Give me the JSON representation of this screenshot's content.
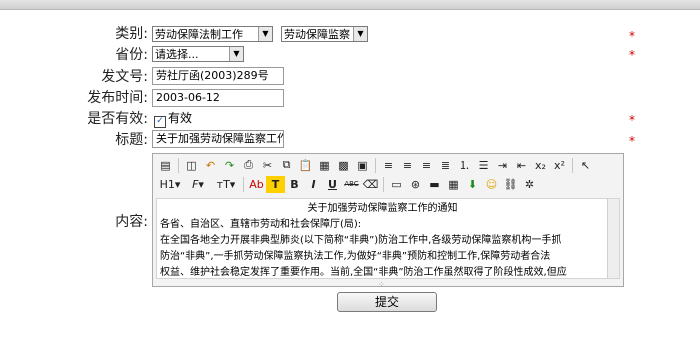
{
  "form": {
    "category": {
      "label": "类别:",
      "value1": "劳动保障法制工作",
      "value2": "劳动保障监察"
    },
    "province": {
      "label": "省份:",
      "value": "请选择..."
    },
    "doc_number": {
      "label": "发文号:",
      "value": "劳社厅函(2003)289号"
    },
    "publish_date": {
      "label": "发布时间:",
      "value": "2003-06-12"
    },
    "valid": {
      "label": "是否有效:",
      "checkbox_label": "有效",
      "checked": true
    },
    "title": {
      "label": "标题:",
      "value": "关于加强劳动保障监察工作"
    },
    "content": {
      "label": "内容:",
      "heading": "关于加强劳动保障监察工作的通知",
      "lines": [
        "各省、自治区、直辖市劳动和社会保障厅(局):",
        "在全国各地全力开展非典型肺炎(以下简称“非典”)防治工作中,各级劳动保障监察机构一手抓",
        "防治“非典”,一手抓劳动保障监察执法工作,为做好“非典”预防和控制工作,保障劳动者合法",
        "权益、维护社会稳定发挥了重要作用。当前,全国“非典”防治工作虽然取得了阶段性成效,但应"
      ]
    },
    "required_mark": "*",
    "submit_label": "提交"
  },
  "toolbar": {
    "row2_labels": {
      "heading": "H1",
      "font_family": "F",
      "font_size": "тT",
      "ab": "Ab",
      "t": "T",
      "bold": "B",
      "italic": "I",
      "underline": "U",
      "strike": "ABC",
      "subscript": "x₂",
      "superscript": "x²"
    }
  }
}
